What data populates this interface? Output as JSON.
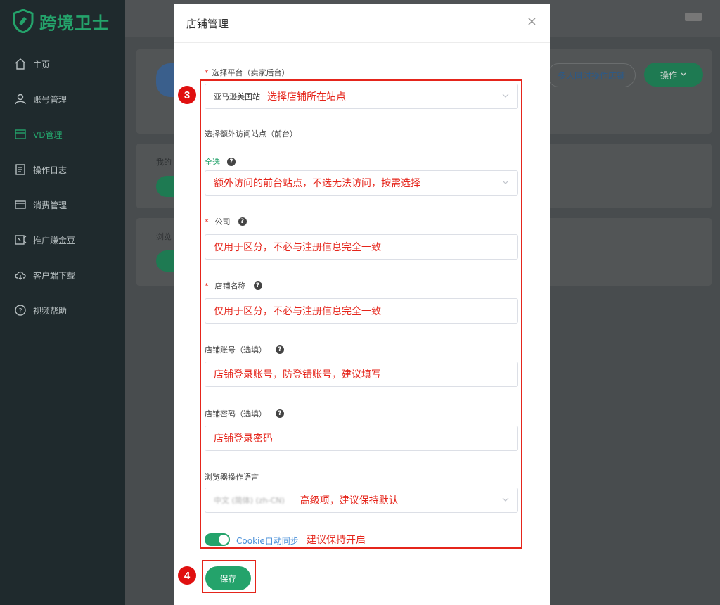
{
  "app": {
    "logo_text": "跨境卫士"
  },
  "sidebar": {
    "items": [
      {
        "label": "主页",
        "icon": "home-icon"
      },
      {
        "label": "账号管理",
        "icon": "user-icon"
      },
      {
        "label": "VD管理",
        "icon": "vd-icon",
        "active": true
      },
      {
        "label": "操作日志",
        "icon": "log-icon"
      },
      {
        "label": "消费管理",
        "icon": "card-icon"
      },
      {
        "label": "推广赚金豆",
        "icon": "promo-icon"
      },
      {
        "label": "客户端下载",
        "icon": "cloud-download-icon"
      },
      {
        "label": "视频帮助",
        "icon": "help-circle-icon"
      }
    ]
  },
  "background": {
    "multi_user_button": "多人同时操作店铺",
    "operate_button": "操作",
    "text_mine": "我的",
    "text_browse": "浏览"
  },
  "modal": {
    "title": "店铺管理",
    "close": "×",
    "platform": {
      "label": "选择平台（卖家后台）",
      "value": "亚马逊美国站",
      "annotation": "选择店铺所在站点"
    },
    "extra_sites": {
      "label": "选择额外访问站点（前台）",
      "select_all": "全选",
      "annotation": "额外访问的前台站点，不选无法访问，按需选择"
    },
    "company": {
      "label": "公司",
      "annotation": "仅用于区分，不必与注册信息完全一致"
    },
    "store_name": {
      "label": "店铺名称",
      "annotation": "仅用于区分，不必与注册信息完全一致"
    },
    "account": {
      "label": "店铺账号（选填）",
      "annotation": "店铺登录账号，防登错账号，建议填写"
    },
    "password": {
      "label": "店铺密码（选填）",
      "annotation": "店铺登录密码"
    },
    "language": {
      "label": "浏览器操作语言",
      "value": "中文 (简体) (zh-CN)",
      "annotation": "高级项，建议保持默认"
    },
    "cookie": {
      "label": "Cookie自动同步",
      "annotation": "建议保持开启",
      "enabled": true
    },
    "save_button": "保存",
    "step_badges": [
      "3",
      "4"
    ]
  },
  "colors": {
    "brand_green": "#24a36b",
    "annotation_red": "#e5251b"
  }
}
